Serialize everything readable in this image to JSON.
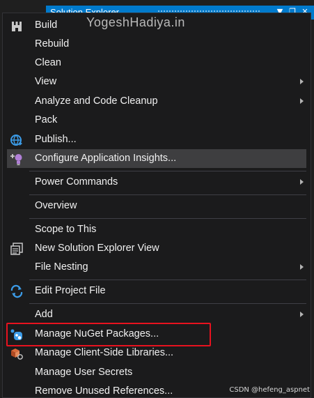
{
  "background_window": {
    "title": "Solution Explorer",
    "buttons": [
      "▼",
      "❐",
      "✕"
    ]
  },
  "watermark": "YogeshHadiya.in",
  "menu": {
    "items": [
      {
        "label": "Build",
        "icon": "build-icon",
        "submenu": false
      },
      {
        "label": "Rebuild",
        "icon": "",
        "submenu": false
      },
      {
        "label": "Clean",
        "icon": "",
        "submenu": false
      },
      {
        "label": "View",
        "icon": "",
        "submenu": true
      },
      {
        "label": "Analyze and Code Cleanup",
        "icon": "",
        "submenu": true
      },
      {
        "label": "Pack",
        "icon": "",
        "submenu": false
      },
      {
        "label": "Publish...",
        "icon": "globe-icon",
        "submenu": false
      },
      {
        "label": "Configure Application Insights...",
        "icon": "lightbulb-icon",
        "submenu": false,
        "highlighted": true
      },
      {
        "label": "Power Commands",
        "icon": "",
        "submenu": true
      },
      {
        "label": "Overview",
        "icon": "",
        "submenu": false
      },
      {
        "label": "Scope to This",
        "icon": "",
        "submenu": false
      },
      {
        "label": "New Solution Explorer View",
        "icon": "solution-explorer-view-icon",
        "submenu": false
      },
      {
        "label": "File Nesting",
        "icon": "",
        "submenu": true
      },
      {
        "label": "Edit Project File",
        "icon": "edit-refresh-icon",
        "submenu": false
      },
      {
        "label": "Add",
        "icon": "",
        "submenu": true
      },
      {
        "label": "Manage NuGet Packages...",
        "icon": "nuget-icon",
        "submenu": false
      },
      {
        "label": "Manage Client-Side Libraries...",
        "icon": "client-libraries-icon",
        "submenu": false
      },
      {
        "label": "Manage User Secrets",
        "icon": "",
        "submenu": false
      },
      {
        "label": "Remove Unused References...",
        "icon": "",
        "submenu": false
      }
    ]
  },
  "credit": "CSDN @hefeng_aspnet",
  "colors": {
    "menu_background": "#1b1b1c",
    "highlight": "#3e3e40",
    "text": "#f1f1f1",
    "accent_blue": "#007acc",
    "callout_red": "#e8121f"
  }
}
